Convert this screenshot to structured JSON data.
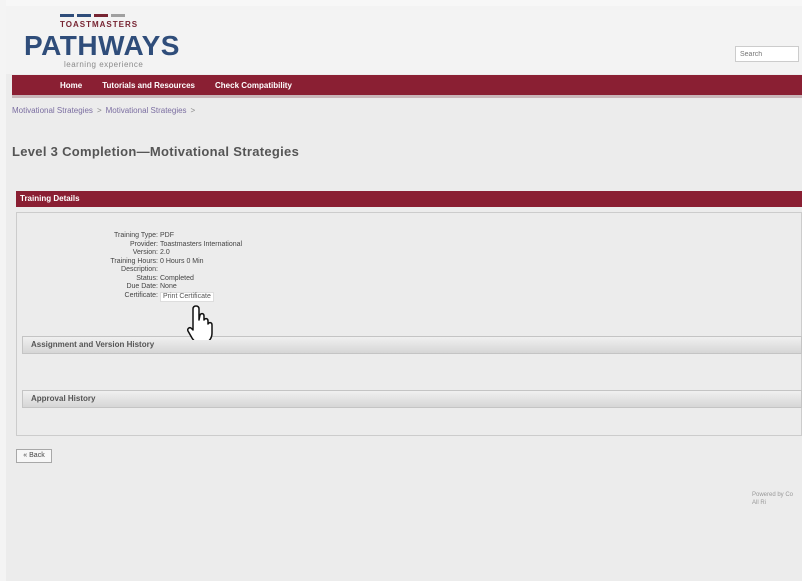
{
  "header": {
    "logo_top": "TOASTMASTERS",
    "logo_main": "PATHWAYS",
    "logo_sub": "learning experience",
    "search_placeholder": "Search"
  },
  "nav": {
    "items": [
      {
        "label": "Home"
      },
      {
        "label": "Tutorials and Resources"
      },
      {
        "label": "Check Compatibility"
      }
    ]
  },
  "breadcrumb": {
    "items": [
      "Motivational Strategies",
      "Motivational Strategies"
    ]
  },
  "page_title": "Level 3 Completion—Motivational Strategies",
  "training_details": {
    "header": "Training Details",
    "rows": [
      {
        "label": "Training Type:",
        "value": "PDF"
      },
      {
        "label": "Provider:",
        "value": "Toastmasters International"
      },
      {
        "label": "Version:",
        "value": "2.0"
      },
      {
        "label": "Training Hours:",
        "value": "0 Hours 0 Min"
      },
      {
        "label": "Description:",
        "value": ""
      },
      {
        "label": "Status:",
        "value": "Completed"
      },
      {
        "label": "Due Date:",
        "value": "None"
      },
      {
        "label": "Certificate:",
        "value": "Print Certificate"
      }
    ]
  },
  "sections": {
    "assignment_history": "Assignment and Version History",
    "approval_history": "Approval History"
  },
  "back_label": "« Back",
  "footer": {
    "line1": "Powered by Co",
    "line2": "All Ri"
  },
  "colors": {
    "brand_maroon": "#8a1f33",
    "brand_blue": "#2f4d7a"
  }
}
